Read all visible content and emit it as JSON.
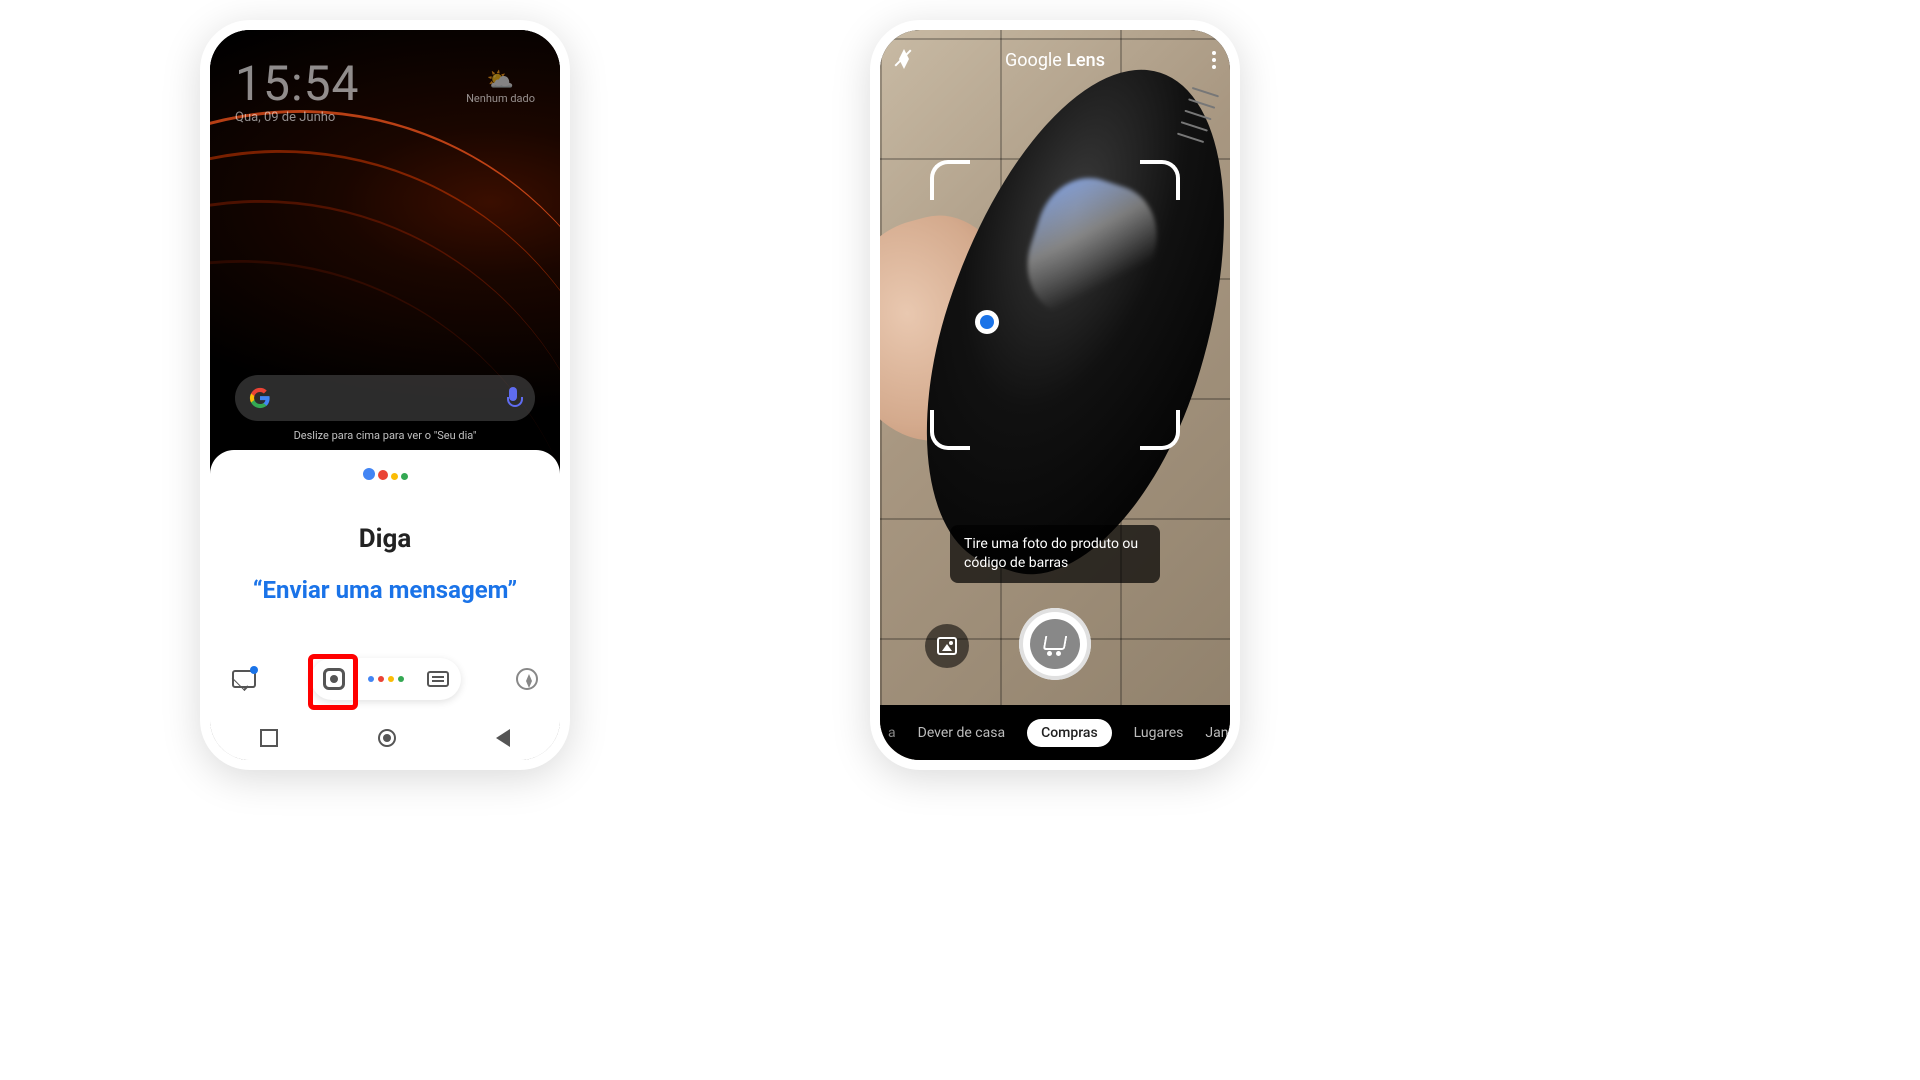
{
  "left": {
    "clock": {
      "time": "15:54",
      "date": "Qua, 09 de Junho"
    },
    "weather": {
      "label": "Nenhum dado"
    },
    "swipe_hint": "Deslize para cima para ver o \"Seu dia\"",
    "assistant": {
      "say": "Diga",
      "example": "“Enviar uma mensagem”"
    }
  },
  "right": {
    "title_a": "Google ",
    "title_b": "Lens",
    "hint": "Tire uma foto do produto ou código de barras",
    "modes": {
      "cut_left": "a",
      "items": [
        "Dever de casa",
        "Compras",
        "Lugares",
        "Jantar"
      ],
      "active": "Compras"
    }
  }
}
